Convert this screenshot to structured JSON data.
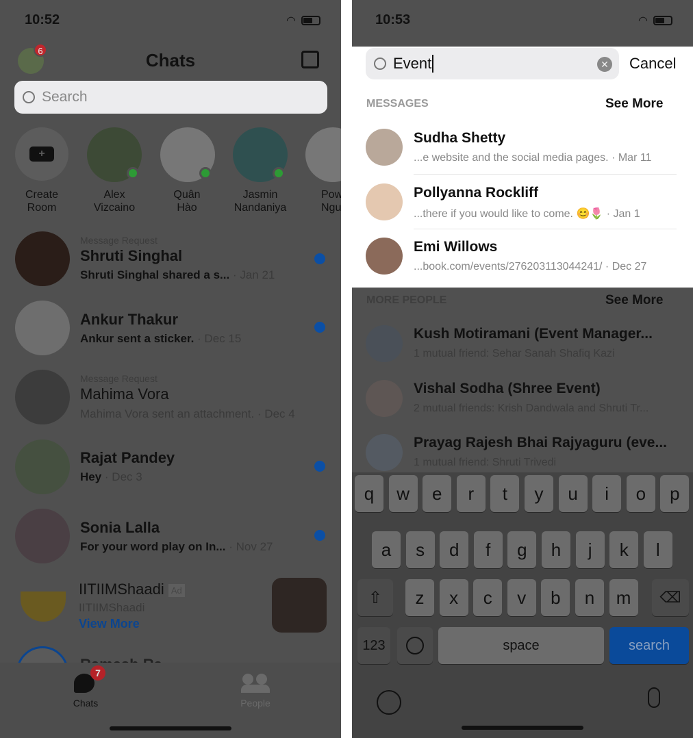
{
  "left": {
    "status": {
      "time": "10:52"
    },
    "header": {
      "title": "Chats",
      "profile_badge": "6",
      "compose_icon": "compose-icon"
    },
    "search": {
      "placeholder": "Search"
    },
    "stories": [
      {
        "line1": "Create",
        "line2": "Room"
      },
      {
        "line1": "Alex",
        "line2": "Vizcaino"
      },
      {
        "line1": "Quân",
        "line2": "Hào"
      },
      {
        "line1": "Jasmin",
        "line2": "Nandaniya"
      },
      {
        "line1": "Pow",
        "line2": "Nguyê"
      }
    ],
    "chats": [
      {
        "request": "Message Request",
        "name": "Shruti Singhal",
        "preview": "Shruti Singhal shared a s...",
        "date": " · Jan 21",
        "unread": true
      },
      {
        "request": "",
        "name": "Ankur Thakur",
        "preview": "Ankur sent a sticker.",
        "date": " · Dec 15",
        "unread": true
      },
      {
        "request": "Message Request",
        "name": "Mahima Vora",
        "preview": "Mahima Vora sent an attachment.",
        "date": " · Dec 4",
        "unread": false
      },
      {
        "request": "",
        "name": "Rajat Pandey",
        "preview": "Hey",
        "date": " · Dec 3",
        "unread": true
      },
      {
        "request": "",
        "name": "Sonia Lalla",
        "preview": "For your word play on In...",
        "date": " · Nov 27",
        "unread": true
      }
    ],
    "ad": {
      "name": "IITIIMShaadi",
      "badge": "Ad",
      "sub": "IITIIMShaadi",
      "link": "View More"
    },
    "partial": "Ramesh Ra...",
    "tabs": [
      {
        "label": "Chats",
        "badge": "7"
      },
      {
        "label": "People"
      }
    ]
  },
  "right": {
    "status": {
      "time": "10:53"
    },
    "search": {
      "value": "Event",
      "cancel": "Cancel"
    },
    "messages": {
      "title": "MESSAGES",
      "see_more": "See More",
      "items": [
        {
          "name": "Sudha Shetty",
          "preview": "...e website and the social media pages. · Mar 11"
        },
        {
          "name": "Pollyanna Rockliff",
          "preview": "...there if you would like to come. 😊🌷 · Jan 1"
        },
        {
          "name": "Emi Willows",
          "preview": "...book.com/events/276203113044241/ · Dec 27"
        }
      ]
    },
    "people": {
      "title": "MORE PEOPLE",
      "see_more": "See More",
      "items": [
        {
          "name": "Kush Motiramani (Event Manager...",
          "sub": "1 mutual friend: Sehar Sanah Shafiq Kazi"
        },
        {
          "name": "Vishal Sodha (Shree Event)",
          "sub": "2 mutual friends: Krish Dandwala and Shruti Tr..."
        },
        {
          "name": "Prayag Rajesh Bhai Rajyaguru (eve...",
          "sub": "1 mutual friend: Shruti Trivedi"
        }
      ]
    },
    "keyboard": {
      "row1": [
        "q",
        "w",
        "e",
        "r",
        "t",
        "y",
        "u",
        "i",
        "o",
        "p"
      ],
      "row2": [
        "a",
        "s",
        "d",
        "f",
        "g",
        "h",
        "j",
        "k",
        "l"
      ],
      "row3": [
        "z",
        "x",
        "c",
        "v",
        "b",
        "n",
        "m"
      ],
      "numbers": "123",
      "space": "space",
      "search": "search"
    }
  },
  "colors": {
    "accent": "#0b4fa5",
    "online": "#2d9b35",
    "badge": "#d8262c"
  }
}
